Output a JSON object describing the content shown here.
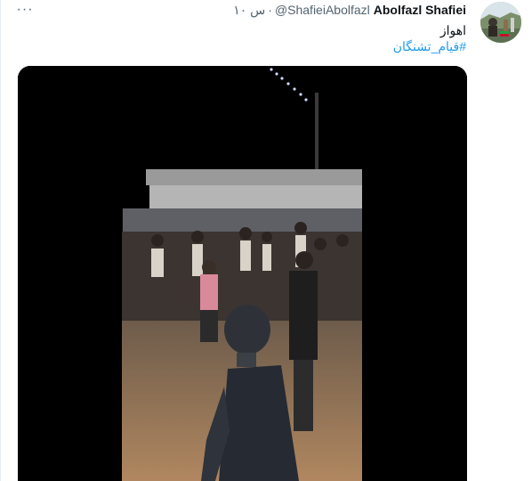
{
  "tweet": {
    "author_name": "Abolfazl Shafiei",
    "author_handle": "@ShafieiAbolfazl",
    "separator": "·",
    "time": "۱۰ س",
    "text": "اهواز",
    "hashtag": "#قیام_تشنگان",
    "more_label": "···"
  },
  "media": {
    "type": "video"
  },
  "colors": {
    "name": "#0f1419",
    "secondary_text": "#536471",
    "link": "#1d9bf0",
    "media_background": "#000000"
  }
}
